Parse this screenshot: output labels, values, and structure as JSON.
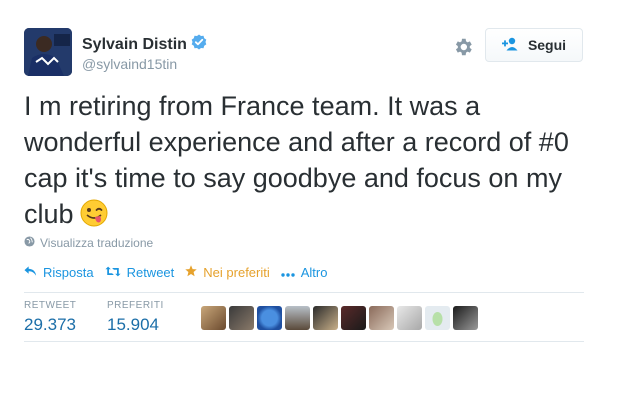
{
  "author": {
    "name": "Sylvain Distin",
    "handle": "@sylvaind15tin",
    "verified": true
  },
  "header": {
    "settings_icon": "gear-icon",
    "follow_label": "Segui",
    "follow_icon": "add-user-icon"
  },
  "tweet": {
    "text": "I m retiring from France team. It was a wonderful experience and after a record of #0 cap it's time to say goodbye and focus on my club",
    "emoji": "winking-face-with-tongue"
  },
  "translate": {
    "label": "Visualizza traduzione",
    "icon": "globe-icon"
  },
  "actions": [
    {
      "label": "Risposta",
      "icon": "reply-icon"
    },
    {
      "label": "Retweet",
      "icon": "retweet-icon"
    },
    {
      "label": "Nei preferiti",
      "icon": "star-icon"
    },
    {
      "label": "Altro",
      "icon": "more-dots-icon"
    }
  ],
  "stats": {
    "retweets_label": "RETWEET",
    "retweets_value": "29.373",
    "favorites_label": "PREFERITI",
    "favorites_value": "15.904"
  },
  "favoriters_count_shown": 10,
  "colors": {
    "link": "#1b95e0",
    "favorite": "#e6a22d",
    "verified": "#55acee",
    "muted": "#8899a6",
    "stat_value": "#1b6ea8"
  }
}
